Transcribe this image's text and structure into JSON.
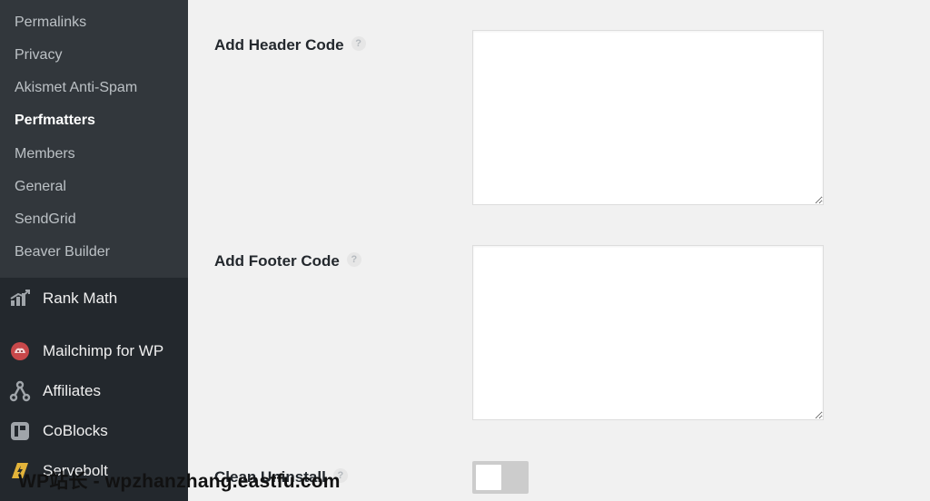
{
  "sidebar": {
    "submenu": [
      {
        "label": "Permalinks",
        "current": false
      },
      {
        "label": "Privacy",
        "current": false
      },
      {
        "label": "Akismet Anti-Spam",
        "current": false
      },
      {
        "label": "Perfmatters",
        "current": true
      },
      {
        "label": "Members",
        "current": false
      },
      {
        "label": "General",
        "current": false
      },
      {
        "label": "SendGrid",
        "current": false
      },
      {
        "label": "Beaver Builder",
        "current": false
      }
    ],
    "menu": [
      {
        "label": "Rank Math",
        "icon": "rank-math-icon"
      },
      {
        "label": "Mailchimp for WP",
        "icon": "mailchimp-icon"
      },
      {
        "label": "Affiliates",
        "icon": "affiliates-icon"
      },
      {
        "label": "CoBlocks",
        "icon": "coblocks-icon"
      },
      {
        "label": "Servebolt",
        "icon": "servebolt-icon"
      }
    ]
  },
  "main": {
    "header_code": {
      "label": "Add Header Code",
      "help": "?",
      "value": ""
    },
    "footer_code": {
      "label": "Add Footer Code",
      "help": "?",
      "value": ""
    },
    "clean_uninstall": {
      "label": "Clean Uninstall",
      "help": "?",
      "enabled": false
    }
  },
  "watermark": "WP站长 - wpzhanzhang.eastfu.com",
  "colors": {
    "sidebar_bg": "#23282d",
    "submenu_bg": "#32373c",
    "page_bg": "#f1f1f1",
    "mailchimp_icon": "#c8484a"
  }
}
